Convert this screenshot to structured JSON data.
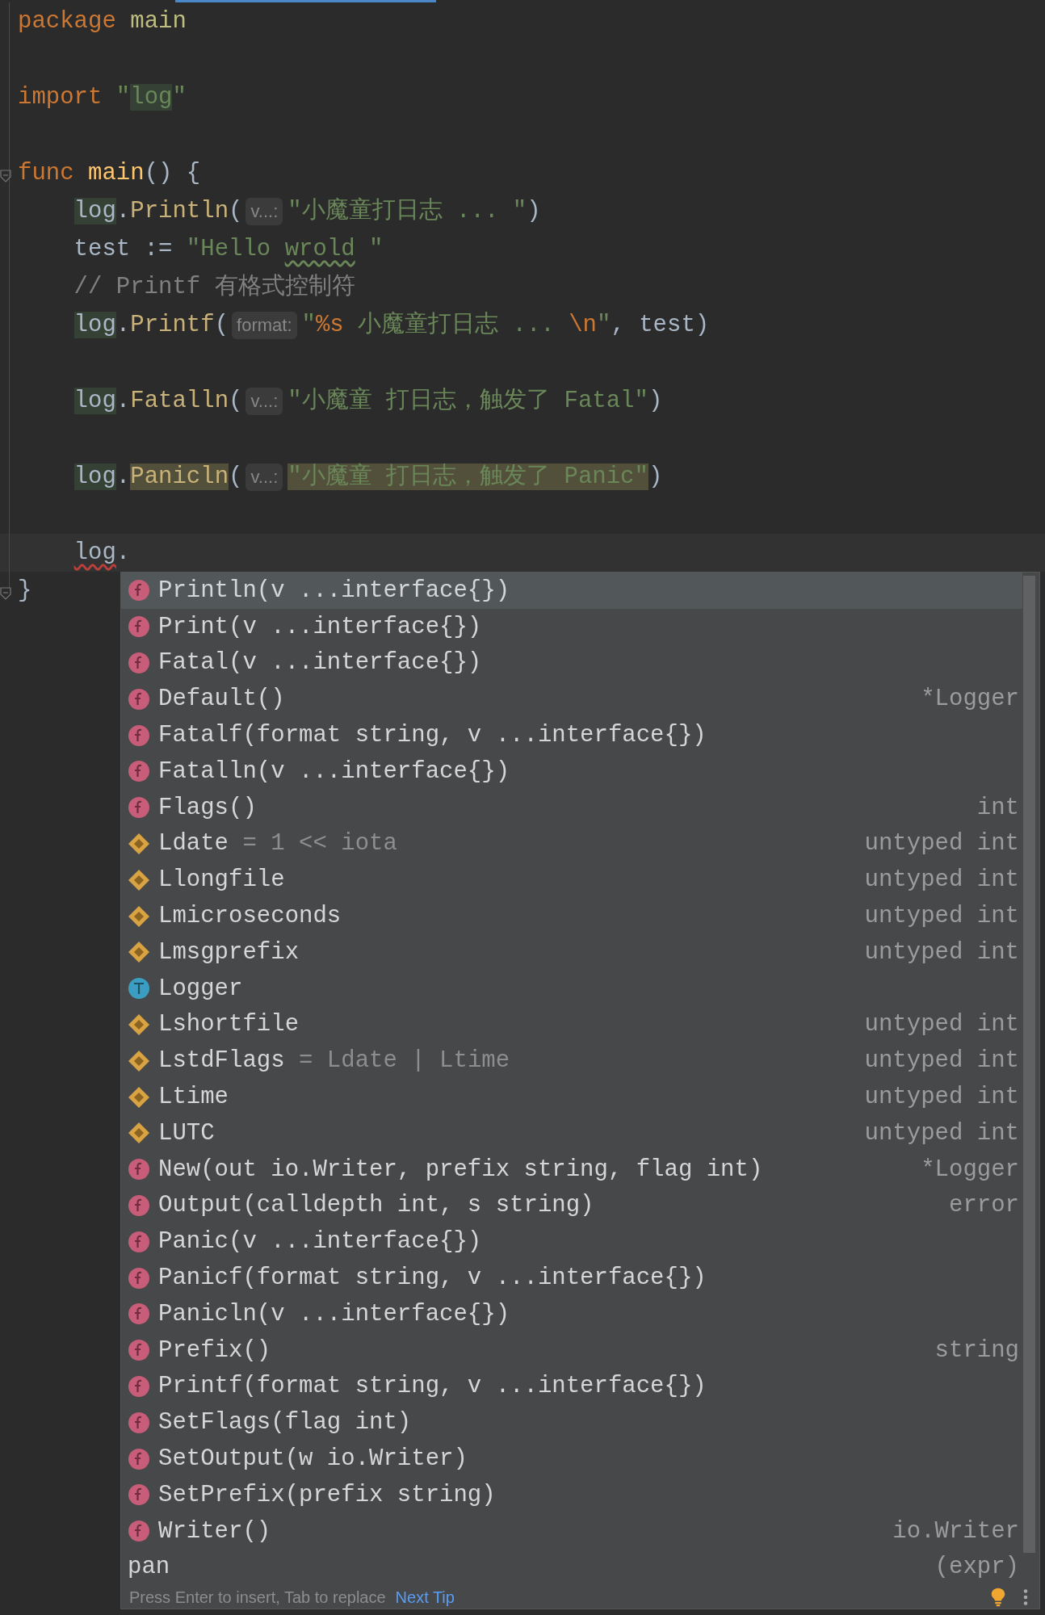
{
  "editor": {
    "lines": [
      {
        "current": false,
        "tokens": [
          {
            "kind": "keyword",
            "text": "package"
          },
          {
            "kind": "package_name",
            "text": " main"
          }
        ]
      },
      {
        "current": false
      },
      {
        "current": false,
        "tokens": [
          {
            "kind": "keyword",
            "text": "import"
          },
          {
            "kind": "string",
            "text": " \""
          },
          {
            "kind": "string_usage",
            "text": "log"
          },
          {
            "kind": "string",
            "text": "\""
          }
        ]
      },
      {
        "current": false
      },
      {
        "current": false,
        "fold": true,
        "tokens": [
          {
            "kind": "keyword",
            "text": "func"
          },
          {
            "kind": "func_decl",
            "text": " main"
          },
          {
            "kind": "plain",
            "text": "() {"
          }
        ]
      },
      {
        "current": false,
        "indented": true,
        "tokens": [
          {
            "kind": "plain_usage",
            "text": "log"
          },
          {
            "kind": "plain",
            "text": "."
          },
          {
            "kind": "func",
            "text": "Println"
          },
          {
            "kind": "plain",
            "text": "("
          },
          {
            "kind": "hint",
            "text": "v...:"
          },
          {
            "kind": "string",
            "text": "\"小魔童打日志 ... \""
          },
          {
            "kind": "plain",
            "text": ")"
          }
        ]
      },
      {
        "current": false,
        "indented": true,
        "tokens": [
          {
            "kind": "plain",
            "text": "test := "
          },
          {
            "kind": "string",
            "text": "\"Hello "
          },
          {
            "kind": "string_typo",
            "text": "wrold"
          },
          {
            "kind": "string",
            "text": " \""
          }
        ]
      },
      {
        "current": false,
        "indented": true,
        "tokens": [
          {
            "kind": "comment",
            "text": "// Printf 有格式控制符"
          }
        ]
      },
      {
        "current": false,
        "indented": true,
        "tokens": [
          {
            "kind": "plain_usage",
            "text": "log"
          },
          {
            "kind": "plain",
            "text": "."
          },
          {
            "kind": "func",
            "text": "Printf"
          },
          {
            "kind": "plain",
            "text": "("
          },
          {
            "kind": "hint",
            "text": "format:"
          },
          {
            "kind": "string",
            "text": "\""
          },
          {
            "kind": "escape",
            "text": "%s"
          },
          {
            "kind": "string",
            "text": " 小魔童打日志 ... "
          },
          {
            "kind": "escape",
            "text": "\\n"
          },
          {
            "kind": "string",
            "text": "\""
          },
          {
            "kind": "plain",
            "text": ", test)"
          }
        ]
      },
      {
        "current": false
      },
      {
        "current": false,
        "indented": true,
        "tokens": [
          {
            "kind": "plain_usage",
            "text": "log"
          },
          {
            "kind": "plain",
            "text": "."
          },
          {
            "kind": "func",
            "text": "Fatalln"
          },
          {
            "kind": "plain",
            "text": "("
          },
          {
            "kind": "hint",
            "text": "v...:"
          },
          {
            "kind": "string",
            "text": "\"小魔童 打日志，触发了 Fatal\""
          },
          {
            "kind": "plain",
            "text": ")"
          }
        ]
      },
      {
        "current": false
      },
      {
        "current": false,
        "indented": true,
        "tokens": [
          {
            "kind": "plain_usage",
            "text": "log"
          },
          {
            "kind": "plain",
            "text": "."
          },
          {
            "kind": "func_match",
            "text": "Panicln"
          },
          {
            "kind": "plain",
            "text": "("
          },
          {
            "kind": "hint",
            "text": "v...:"
          },
          {
            "kind": "string_match",
            "text": "\"小魔童 打日志，触发了 Panic\""
          },
          {
            "kind": "plain",
            "text": ")"
          }
        ]
      },
      {
        "current": false
      },
      {
        "current": true,
        "indented": true,
        "tokens": [
          {
            "kind": "plain_error",
            "text": "log"
          },
          {
            "kind": "plain",
            "text": "."
          }
        ]
      },
      {
        "current": false,
        "fold": true,
        "tokens": [
          {
            "kind": "plain",
            "text": "}"
          }
        ]
      }
    ]
  },
  "completion": {
    "items": [
      {
        "kind": "function",
        "label": "Println(v ...interface{})",
        "selected": true
      },
      {
        "kind": "function",
        "label": "Print(v ...interface{})",
        "selected": false
      },
      {
        "kind": "function",
        "label": "Fatal(v ...interface{})",
        "selected": false
      },
      {
        "kind": "function",
        "label": "Default()",
        "type": "*Logger",
        "selected": false
      },
      {
        "kind": "function",
        "label": "Fatalf(format string, v ...interface{})",
        "selected": false
      },
      {
        "kind": "function",
        "label": "Fatalln(v ...interface{})",
        "selected": false
      },
      {
        "kind": "function",
        "label": "Flags()",
        "type": "int",
        "selected": false
      },
      {
        "kind": "constant",
        "label": "Ldate",
        "detail": " = 1 << iota",
        "type": "untyped int",
        "selected": false
      },
      {
        "kind": "constant",
        "label": "Llongfile",
        "type": "untyped int",
        "selected": false
      },
      {
        "kind": "constant",
        "label": "Lmicroseconds",
        "type": "untyped int",
        "selected": false
      },
      {
        "kind": "constant",
        "label": "Lmsgprefix",
        "type": "untyped int",
        "selected": false
      },
      {
        "kind": "type",
        "label": "Logger",
        "selected": false
      },
      {
        "kind": "constant",
        "label": "Lshortfile",
        "type": "untyped int",
        "selected": false
      },
      {
        "kind": "constant",
        "label": "LstdFlags",
        "detail": " = Ldate | Ltime",
        "type": "untyped int",
        "selected": false
      },
      {
        "kind": "constant",
        "label": "Ltime",
        "type": "untyped int",
        "selected": false
      },
      {
        "kind": "constant",
        "label": "LUTC",
        "type": "untyped int",
        "selected": false
      },
      {
        "kind": "function",
        "label": "New(out io.Writer, prefix string, flag int)",
        "type": "*Logger",
        "selected": false
      },
      {
        "kind": "function",
        "label": "Output(calldepth int, s string)",
        "result": "error",
        "selected": false
      },
      {
        "kind": "function",
        "label": "Panic(v ...interface{})",
        "selected": false
      },
      {
        "kind": "function",
        "label": "Panicf(format string, v ...interface{})",
        "selected": false
      },
      {
        "kind": "function",
        "label": "Panicln(v ...interface{})",
        "selected": false
      },
      {
        "kind": "function",
        "label": "Prefix()",
        "type": "string",
        "selected": false
      },
      {
        "kind": "function",
        "label": "Printf(format string, v ...interface{})",
        "selected": false
      },
      {
        "kind": "function",
        "label": "SetFlags(flag int)",
        "selected": false
      },
      {
        "kind": "function",
        "label": "SetOutput(w io.Writer)",
        "selected": false
      },
      {
        "kind": "function",
        "label": "SetPrefix(prefix string)",
        "selected": false
      },
      {
        "kind": "function",
        "label": "Writer()",
        "type": "io.Writer",
        "selected": false
      },
      {
        "kind": "template",
        "label": "pan",
        "type": "(expr)",
        "selected": false
      }
    ],
    "footer": {
      "hint": "Press Enter to insert, Tab to replace",
      "link": "Next Tip"
    }
  }
}
